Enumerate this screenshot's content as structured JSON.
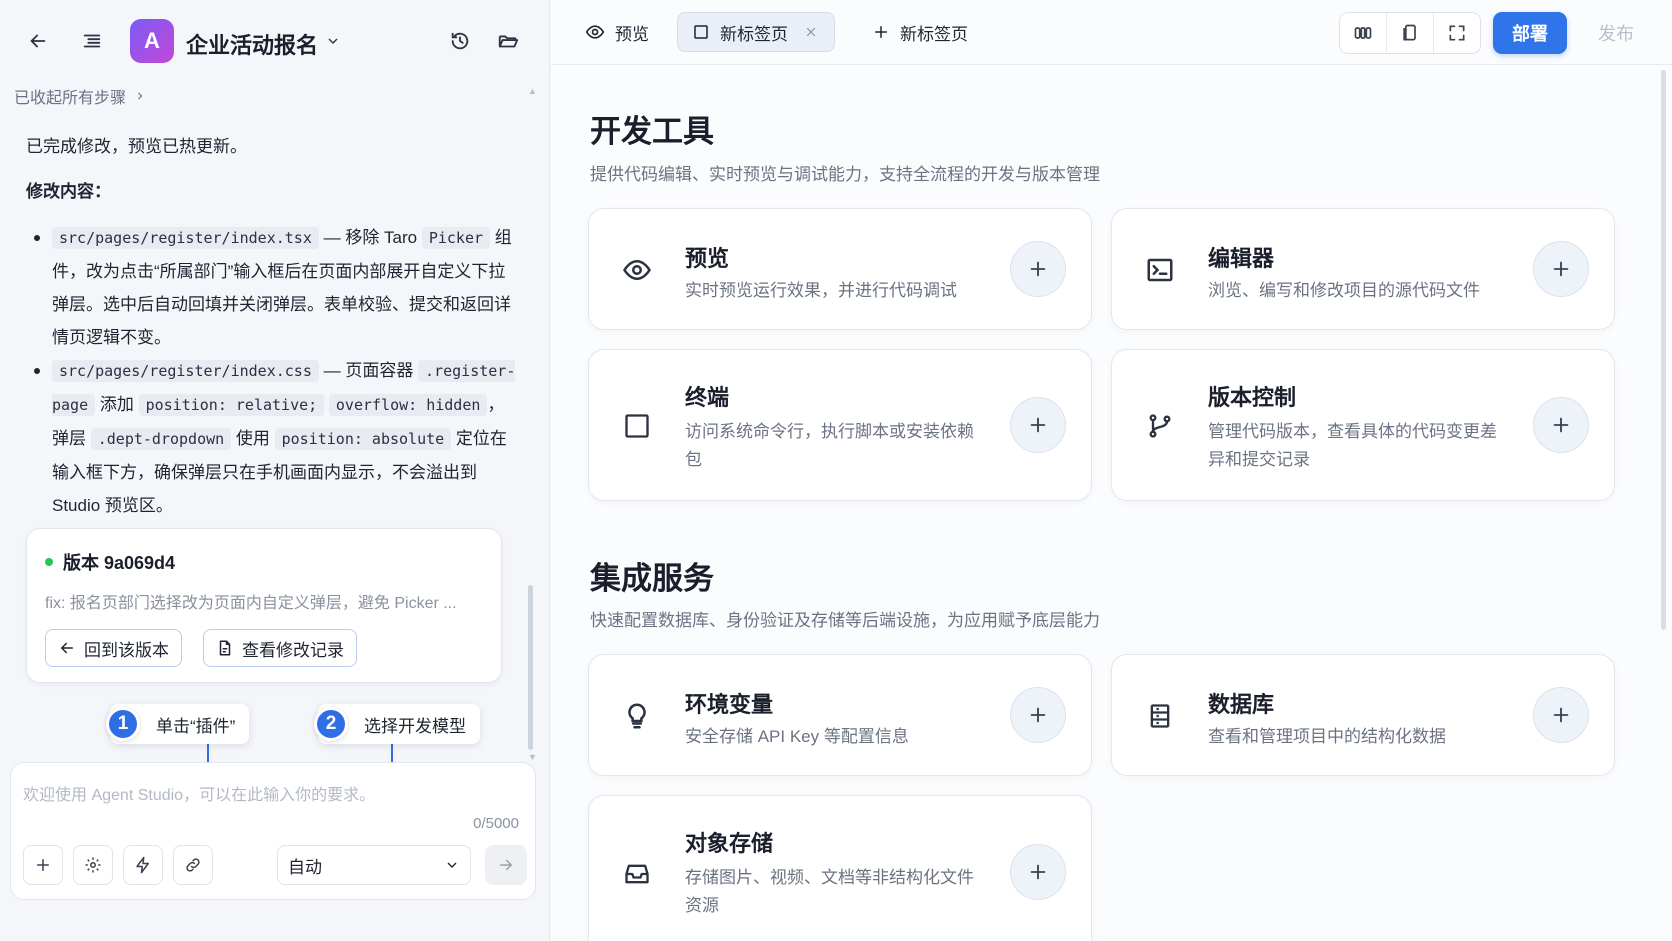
{
  "app": {
    "logo_letter": "A",
    "title": "企业活动报名"
  },
  "chat": {
    "collapsed_steps": "已收起所有步骤",
    "done_message": "已完成修改，预览已热更新。",
    "changes_heading": "修改内容：",
    "change1": {
      "file": "src/pages/register/index.tsx",
      "t1": " — 移除 Taro ",
      "code1": "Picker",
      "t2": " 组件，改为点击“所属部门”输入框后在页面内部展开自定义下拉弹层。选中后自动回填并关闭弹层。表单校验、提交和返回详情页逻辑不变。"
    },
    "change2": {
      "file": "src/pages/register/index.css",
      "t1": " — 页面容器 ",
      "code1": ".register-page",
      "t2": " 添加 ",
      "code2": "position: relative;",
      "t3": " ",
      "code3": "overflow: hidden",
      "t4": "，弹层 ",
      "code4": ".dept-dropdown",
      "t5": " 使用 ",
      "code5": "position: absolute",
      "t6": " 定位在输入框下方，确保弹层只在手机画面内显示，不会溢出到 Studio 预览区。"
    },
    "version": {
      "title": "版本 9a069d4",
      "subtitle": "fix: 报名页部门选择改为页面内自定义弹层，避免 Picker ...",
      "revert_label": "回到该版本",
      "history_label": "查看修改记录",
      "status_color": "#22c55e"
    },
    "callouts": [
      {
        "num": "1",
        "text": "单击“插件”"
      },
      {
        "num": "2",
        "text": "选择开发模型"
      }
    ],
    "input": {
      "placeholder": "欢迎使用 Agent Studio，可以在此输入你的要求。",
      "counter": "0/5000",
      "model_value": "自动"
    }
  },
  "tabs": [
    {
      "label": "预览",
      "icon": "eye-icon"
    },
    {
      "label": "新标签页",
      "icon": "square-icon",
      "active": true
    },
    {
      "label": "新标签页",
      "icon": "plus-icon"
    }
  ],
  "toolbar": {
    "deploy_label": "部署",
    "publish_label": "发布",
    "accent": "#2f74e8"
  },
  "sections": {
    "dev": {
      "title": "开发工具",
      "subtitle": "提供代码编辑、实时预览与调试能力，支持全流程的开发与版本管理",
      "cards": [
        {
          "title": "预览",
          "desc": "实时预览运行效果，并进行代码调试",
          "icon": "eye-icon"
        },
        {
          "title": "编辑器",
          "desc": "浏览、编写和修改项目的源代码文件",
          "icon": "code-editor-icon"
        },
        {
          "title": "终端",
          "desc": "访问系统命令行，执行脚本或安装依赖包",
          "icon": "terminal-icon"
        },
        {
          "title": "版本控制",
          "desc": "管理代码版本，查看具体的代码变更差异和提交记录",
          "icon": "git-branch-icon"
        }
      ]
    },
    "integration": {
      "title": "集成服务",
      "subtitle": "快速配置数据库、身份验证及存储等后端设施，为应用赋予底层能力",
      "cards": [
        {
          "title": "环境变量",
          "desc": "安全存储 API Key 等配置信息",
          "icon": "lightbulb-icon"
        },
        {
          "title": "数据库",
          "desc": "查看和管理项目中的结构化数据",
          "icon": "database-icon"
        },
        {
          "title": "对象存储",
          "desc": "存储图片、视频、文档等非结构化文件资源",
          "icon": "inbox-icon"
        }
      ]
    }
  }
}
